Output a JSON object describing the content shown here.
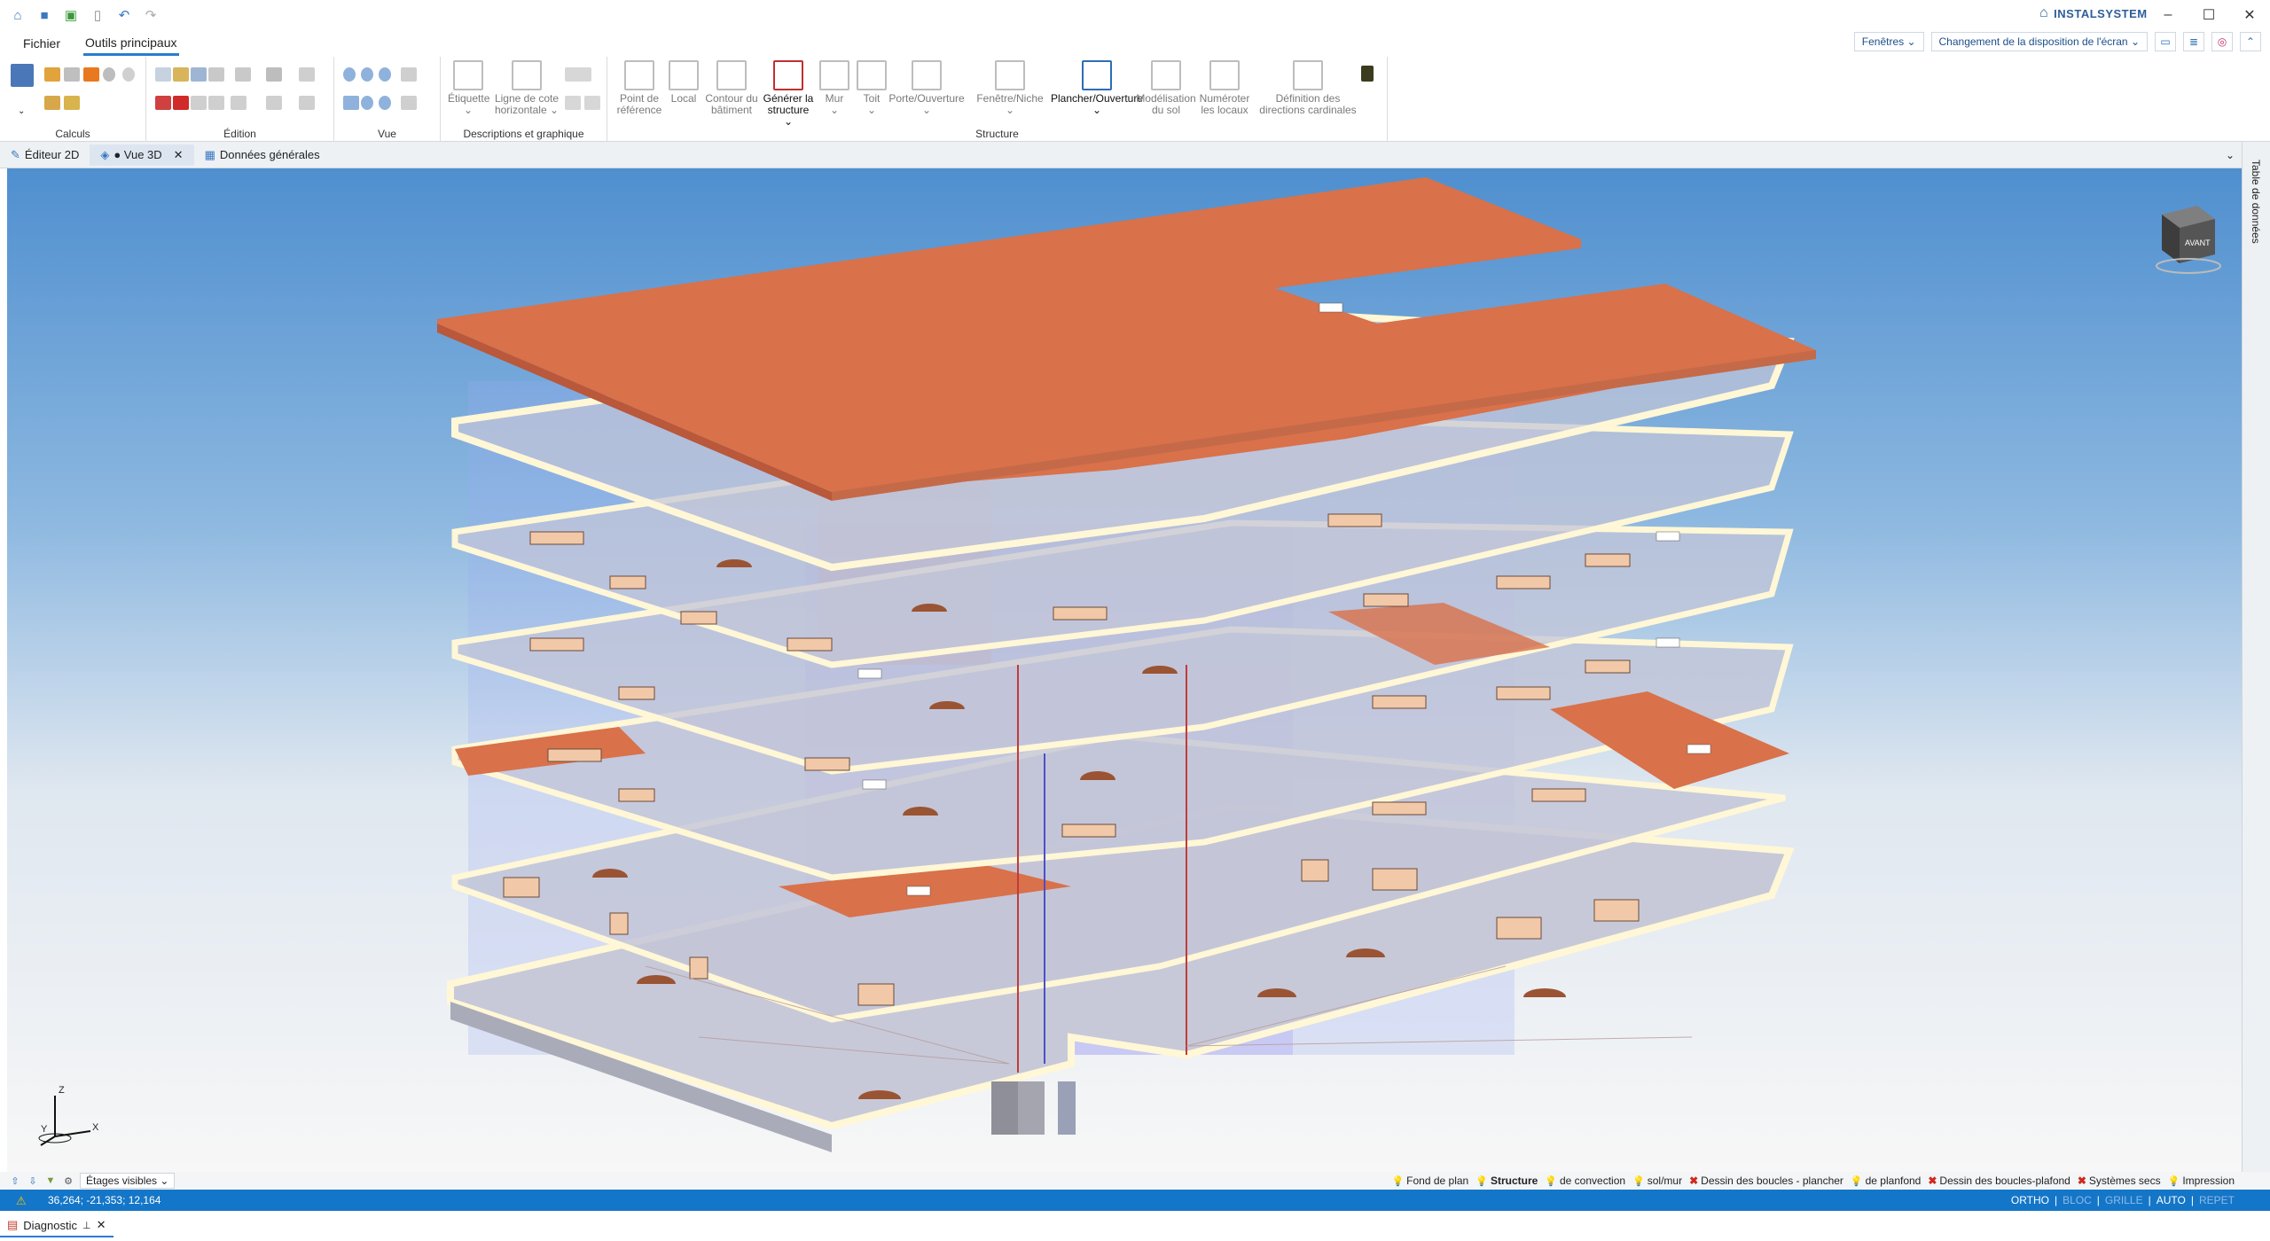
{
  "app": {
    "brand": "INSTALSYSTEM",
    "menu_tabs": [
      "Fichier",
      "Outils principaux"
    ],
    "active_menu_tab": "Outils principaux",
    "windows_dropdown": "Fenêtres",
    "layout_dropdown": "Changement de la disposition de l'écran"
  },
  "ribbon": {
    "groups": {
      "calculs": "Calculs",
      "edition": "Édition",
      "vue": "Vue",
      "descriptions": "Descriptions et graphique",
      "structure": "Structure"
    },
    "buttons": {
      "etiquette": "Étiquette",
      "ligne_cote_1": "Ligne de cote",
      "ligne_cote_2": "horizontale",
      "point_ref_1": "Point de",
      "point_ref_2": "référence",
      "local": "Local",
      "contour_1": "Contour du",
      "contour_2": "bâtiment",
      "generer_1": "Générer la",
      "generer_2": "structure",
      "mur": "Mur",
      "toit": "Toit",
      "porte": "Porte/Ouverture",
      "fenetre": "Fenêtre/Niche",
      "plancher": "Plancher/Ouverture",
      "modelisation_1": "Modélisation",
      "modelisation_2": "du sol",
      "numeroter_1": "Numéroter",
      "numeroter_2": "les locaux",
      "definition_1": "Définition des",
      "definition_2": "directions cardinales"
    }
  },
  "doc_tabs": [
    "Éditeur 2D",
    "● Vue 3D",
    "Données générales"
  ],
  "active_doc_tab": "● Vue 3D",
  "side_panel_title": "Table de données",
  "viewport": {
    "axis_labels": {
      "z": "Z",
      "y": "Y",
      "x": "X"
    },
    "navcube_label": "AVANT"
  },
  "layer_bar": {
    "floors_dropdown": "Étages visibles",
    "layers": [
      {
        "label": "Fond de plan",
        "state": "on",
        "bold": false
      },
      {
        "label": "Structure",
        "state": "on",
        "bold": true
      },
      {
        "label": "de convection",
        "state": "on",
        "bold": false
      },
      {
        "label": "sol/mur",
        "state": "on",
        "bold": false
      },
      {
        "label": "Dessin des boucles - plancher",
        "state": "off",
        "bold": false
      },
      {
        "label": "de planfond",
        "state": "on",
        "bold": false
      },
      {
        "label": "Dessin des boucles-plafond",
        "state": "off",
        "bold": false
      },
      {
        "label": "Systèmes secs",
        "state": "off",
        "bold": false
      },
      {
        "label": "Impression",
        "state": "on",
        "bold": false
      }
    ]
  },
  "status_bar": {
    "coordinates": "36,264; -21,353; 12,164",
    "modes": [
      {
        "label": "ORTHO",
        "active": true
      },
      {
        "label": "BLOC",
        "active": false
      },
      {
        "label": "GRILLE",
        "active": false
      },
      {
        "label": "AUTO",
        "active": true
      },
      {
        "label": "REPET",
        "active": false
      }
    ]
  },
  "bottom_panel": {
    "tab": "Diagnostic"
  },
  "colors": {
    "accent": "#1476c8",
    "roof": "#d9714a",
    "slab_edge": "#fff7d6",
    "sky_top": "#4f8fcf"
  }
}
